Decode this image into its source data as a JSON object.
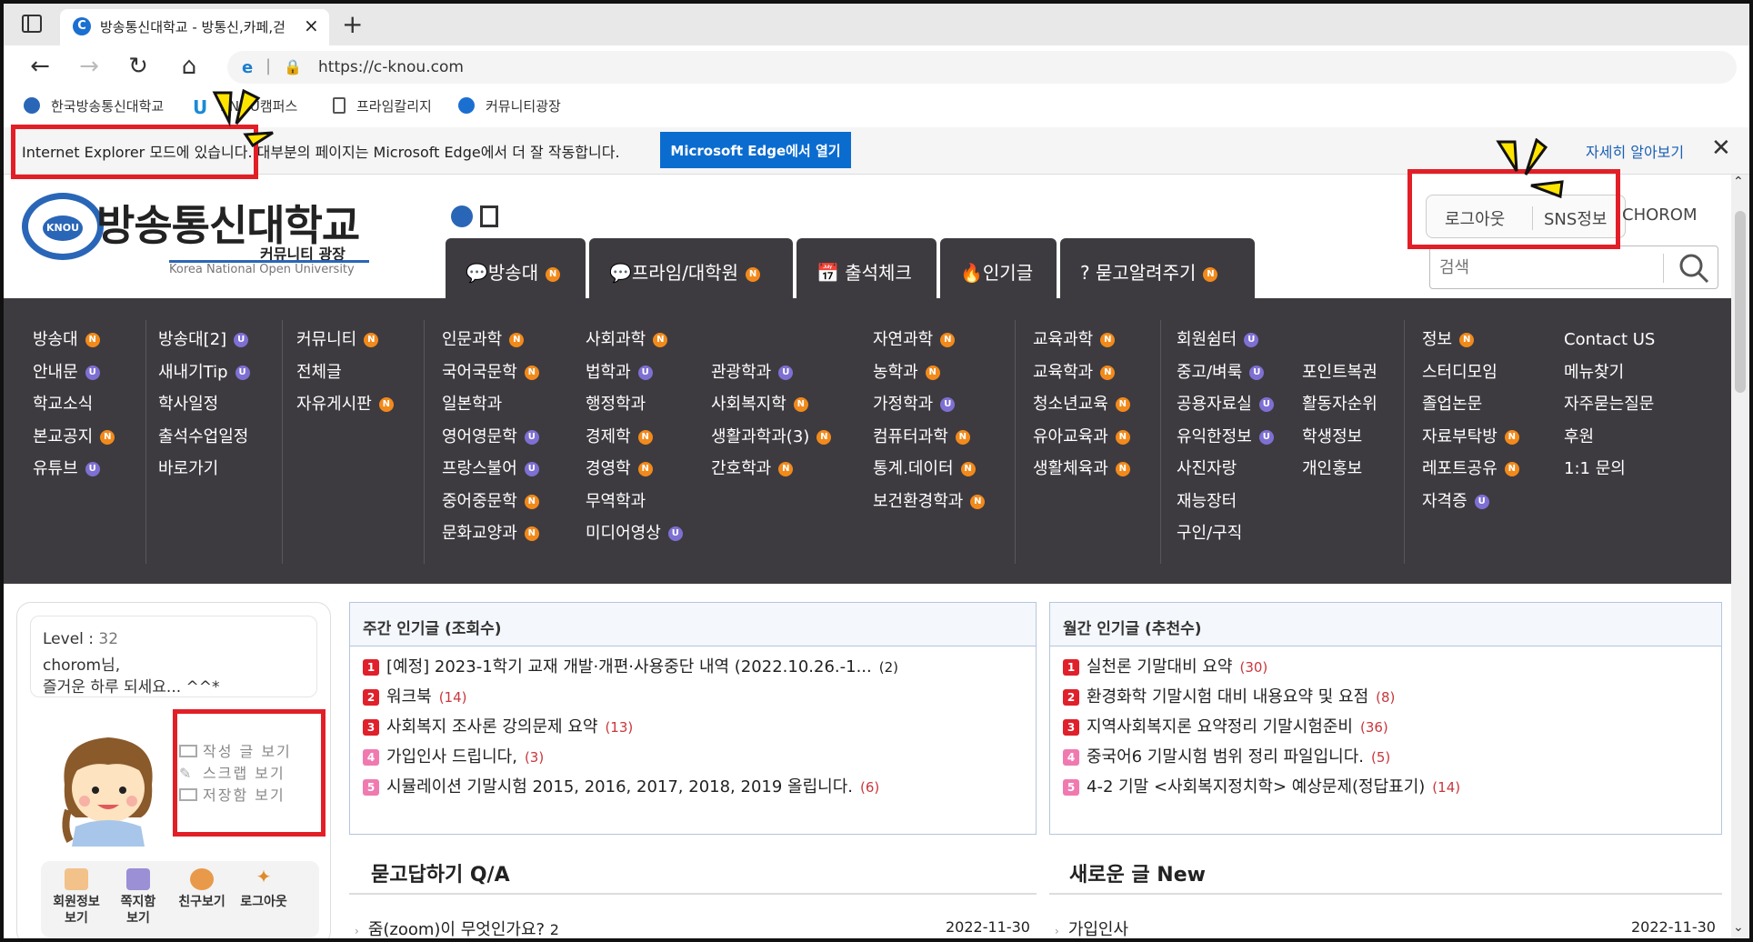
{
  "browser": {
    "tab_title": "방송통신대학교 - 방통신,카페,걷",
    "tab_close": "×",
    "new_tab": "+",
    "url": "https://c-knou.com",
    "bookmarks": [
      "한국방송통신대학교",
      "KNOU캠퍼스",
      "프라임칼리지",
      "커뮤니티광장"
    ],
    "ie_message": "Internet Explorer 모드에 있습니다. 대부분의 페이지는 Microsoft Edge에서 더 잘 작동합니다.",
    "ie_button": "Microsoft Edge에서 열기",
    "ie_more": "자세히 알아보기",
    "ie_close": "✕"
  },
  "site": {
    "logo_text": "방송통신대학교",
    "logo_sub": "커뮤니티 광장",
    "logo_en": "Korea National Open University",
    "logo_badge": "KNOU",
    "tabs": [
      {
        "label": "💬방송대",
        "badge": "N"
      },
      {
        "label": "💬프라임/대학원",
        "badge": "N"
      },
      {
        "label": "📅 출석체크",
        "badge": ""
      },
      {
        "label": "🔥인기글",
        "badge": ""
      },
      {
        "label": "? 묻고알려주기",
        "badge": "N"
      }
    ],
    "logout": "로그아웃",
    "sns": "SNS정보",
    "username": "CHOROM",
    "search_placeholder": "검색"
  },
  "menu": [
    [
      {
        "t": "방송대",
        "b": "N"
      },
      {
        "t": "안내문",
        "b": "U"
      },
      {
        "t": "학교소식",
        "b": ""
      },
      {
        "t": "본교공지",
        "b": "N"
      },
      {
        "t": "유튜브",
        "b": "U"
      }
    ],
    [
      {
        "t": "방송대[2]",
        "b": "U"
      },
      {
        "t": "새내기Tip",
        "b": "U"
      },
      {
        "t": "학사일정",
        "b": ""
      },
      {
        "t": "출석수업일정",
        "b": ""
      },
      {
        "t": "바로가기",
        "b": ""
      }
    ],
    [
      {
        "t": "커뮤니티",
        "b": "N"
      },
      {
        "t": "전체글",
        "b": ""
      },
      {
        "t": "자유게시판",
        "b": "N"
      }
    ],
    [
      {
        "t": "인문과학",
        "b": "N"
      },
      {
        "t": "국어국문학",
        "b": "N"
      },
      {
        "t": "일본학과",
        "b": ""
      },
      {
        "t": "영어영문학",
        "b": "U"
      },
      {
        "t": "프랑스불어",
        "b": "U"
      },
      {
        "t": "중어중문학",
        "b": "N"
      },
      {
        "t": "문화교양과",
        "b": "N"
      }
    ],
    [
      {
        "t": "사회과학",
        "b": "N"
      },
      {
        "t": "법학과",
        "b": "U"
      },
      {
        "t": "행정학과",
        "b": ""
      },
      {
        "t": "경제학",
        "b": "N"
      },
      {
        "t": "경영학",
        "b": "N"
      },
      {
        "t": "무역학과",
        "b": ""
      },
      {
        "t": "미디어영상",
        "b": "U"
      }
    ],
    [
      {
        "t": "",
        "b": ""
      },
      {
        "t": "관광학과",
        "b": "U"
      },
      {
        "t": "사회복지학",
        "b": "N"
      },
      {
        "t": "생활과학과(3)",
        "b": "N"
      },
      {
        "t": "간호학과",
        "b": "N"
      }
    ],
    [
      {
        "t": "자연과학",
        "b": "N"
      },
      {
        "t": "농학과",
        "b": "N"
      },
      {
        "t": "가정학과",
        "b": "U"
      },
      {
        "t": "컴퓨터과학",
        "b": "N"
      },
      {
        "t": "통계.데이터",
        "b": "N"
      },
      {
        "t": "보건환경학과",
        "b": "N"
      }
    ],
    [
      {
        "t": "교육과학",
        "b": "N"
      },
      {
        "t": "교육학과",
        "b": "N"
      },
      {
        "t": "청소년교육",
        "b": "N"
      },
      {
        "t": "유아교육과",
        "b": "N"
      },
      {
        "t": "생활체육과",
        "b": "N"
      }
    ],
    [
      {
        "t": "회원쉼터",
        "b": "U"
      },
      {
        "t": "중고/벼룩",
        "b": "U"
      },
      {
        "t": "공용자료실",
        "b": "U"
      },
      {
        "t": "유익한정보",
        "b": "U"
      },
      {
        "t": "사진자랑",
        "b": ""
      },
      {
        "t": "재능장터",
        "b": ""
      },
      {
        "t": "구인/구직",
        "b": ""
      }
    ],
    [
      {
        "t": "",
        "b": ""
      },
      {
        "t": "포인트복권",
        "b": ""
      },
      {
        "t": "활동자순위",
        "b": ""
      },
      {
        "t": "학생정보",
        "b": ""
      },
      {
        "t": "개인홍보",
        "b": ""
      }
    ],
    [
      {
        "t": "정보",
        "b": "N"
      },
      {
        "t": "스터디모임",
        "b": ""
      },
      {
        "t": "졸업논문",
        "b": ""
      },
      {
        "t": "자료부탁방",
        "b": "N"
      },
      {
        "t": "레포트공유",
        "b": "N"
      },
      {
        "t": "자격증",
        "b": "U"
      }
    ],
    [
      {
        "t": "Contact US",
        "b": ""
      },
      {
        "t": "메뉴찾기",
        "b": ""
      },
      {
        "t": "자주묻는질문",
        "b": ""
      },
      {
        "t": "후원",
        "b": ""
      },
      {
        "t": "1:1 문의",
        "b": ""
      }
    ]
  ],
  "user": {
    "level_label": "Level",
    "level_sep": " : ",
    "level": "32",
    "name": "chorom",
    "greet_suffix": "님,",
    "greet": "즐거운 하루 되세요... ^^*",
    "links": [
      "작성 글 보기",
      "스크랩 보기",
      "저장함 보기"
    ],
    "actions": [
      [
        "회원정보",
        "보기"
      ],
      [
        "쪽지함",
        "보기"
      ],
      [
        "친구보기",
        ""
      ],
      [
        "로그아웃",
        ""
      ]
    ]
  },
  "weekly": {
    "title": "주간 인기글 (조회수)",
    "items": [
      {
        "r": "1",
        "t": "[예정] 2023-1학기 교재 개발·개편·사용중단 내역 (2022.10.26.-1...",
        "c": "(2)"
      },
      {
        "r": "2",
        "t": "워크북",
        "c": "(14)"
      },
      {
        "r": "3",
        "t": "사회복지 조사론 강의문제 요약",
        "c": "(13)"
      },
      {
        "r": "4",
        "t": "가입인사 드립니다,",
        "c": "(3)"
      },
      {
        "r": "5",
        "t": "시뮬레이션 기말시험 2015, 2016, 2017, 2018, 2019 올립니다.",
        "c": "(6)"
      }
    ]
  },
  "monthly": {
    "title": "월간 인기글 (추천수)",
    "items": [
      {
        "r": "1",
        "t": "실천론 기말대비 요약",
        "c": "(30)"
      },
      {
        "r": "2",
        "t": "환경화학 기말시험 대비 내용요약 및 요점",
        "c": "(8)"
      },
      {
        "r": "3",
        "t": "지역사회복지론 요약정리 기말시험준비",
        "c": "(36)"
      },
      {
        "r": "4",
        "t": "중국어6 기말시험 범위 정리 파일입니다.",
        "c": "(5)"
      },
      {
        "r": "5",
        "t": "4-2 기말 <사회복지정치학> 예상문제(정답표기)",
        "c": "(14)"
      }
    ]
  },
  "qa": {
    "title": "묻고답하기 Q/A",
    "row": "줌(zoom)이 무엇인가요?",
    "row_count": "2",
    "date": "2022-11-30"
  },
  "newpost": {
    "title": "새로운 글 New",
    "row": "가입인사",
    "date": "2022-11-30"
  },
  "colors": {
    "menu_bg": "#3e3b40",
    "n_badge": "#f28a1b",
    "u_badge": "#7e70d3",
    "highlight": "#e21f26",
    "edge_blue": "#0a6ccf"
  }
}
